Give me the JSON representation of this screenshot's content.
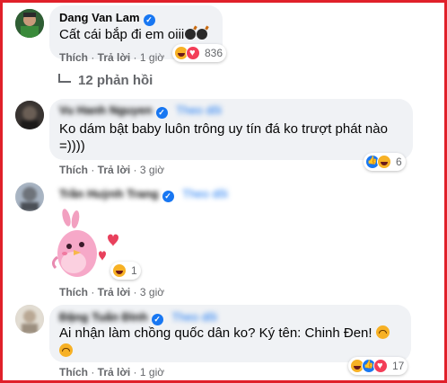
{
  "comment1": {
    "author": "Dang Van Lam",
    "text": "Cất cái bắp đi em oiii",
    "reaction_count": "836",
    "like_label": "Thích",
    "reply_label": "Trả lời",
    "time": "1 giờ"
  },
  "replies_toggle": {
    "label": "12 phản hồi"
  },
  "reply1": {
    "author": "Vu Hanh Nguyen",
    "follow": "Theo dõi",
    "line1": "Ko dám bật baby luôn trông uy tín đá ko trượt phát nào",
    "line2": "=))))",
    "reaction_count": "6",
    "like_label": "Thích",
    "reply_label": "Trả lời",
    "time": "3 giờ"
  },
  "reply2": {
    "author": "Trần Huỳnh Trang",
    "follow": "Theo dõi",
    "sticker": "pink-bird-sticker",
    "reaction_count": "1",
    "like_label": "Thích",
    "reply_label": "Trả lời",
    "time": "3 giờ"
  },
  "reply3": {
    "author": "Đặng Tuấn Đình",
    "follow": "Theo dõi",
    "text": "Ai nhận làm chồng quốc dân ko? Ký tên: Chinh Đen!",
    "reaction_count": "17",
    "like_label": "Thích",
    "reply_label": "Trả lời",
    "time": "1 giờ"
  },
  "colors": {
    "frame_border": "#e0202a",
    "bubble": "#f0f2f5",
    "secondary_text": "#65676b",
    "verified": "#1877f2"
  }
}
